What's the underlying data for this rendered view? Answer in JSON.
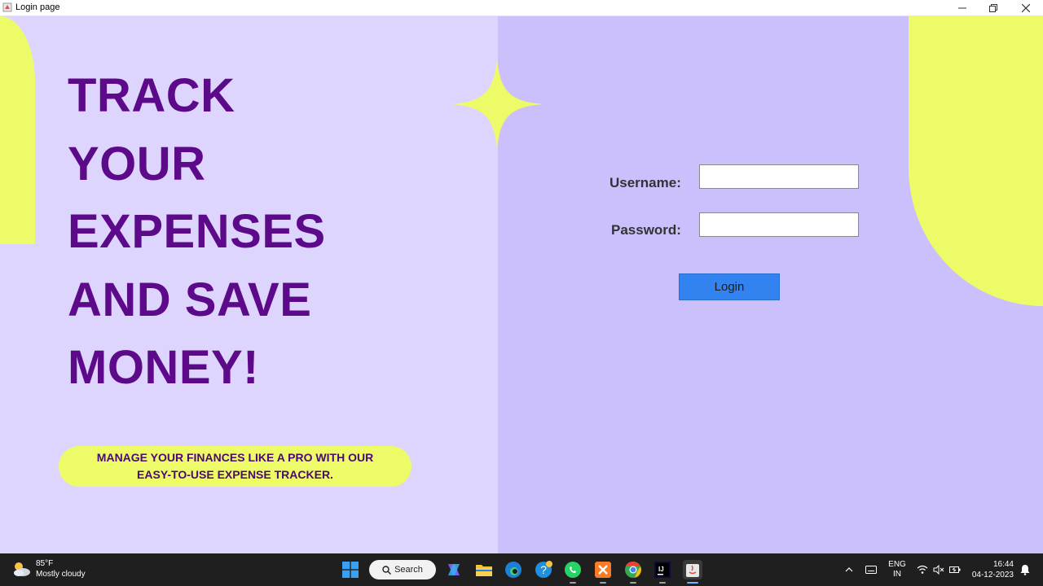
{
  "window": {
    "title": "Login page",
    "minimize_icon": "minimize-icon",
    "maximize_icon": "restore-icon",
    "close_icon": "close-icon"
  },
  "hero": {
    "headline_lines": [
      "TRACK",
      "YOUR",
      "EXPENSES",
      "AND SAVE",
      "MONEY!"
    ],
    "tagline": "MANAGE YOUR FINANCES LIKE A PRO WITH OUR EASY-TO-USE EXPENSE TRACKER."
  },
  "login_form": {
    "username_label": "Username:",
    "username_value": "",
    "password_label": "Password:",
    "password_value": "",
    "login_button": "Login"
  },
  "colors": {
    "left_bg": "#ddd5fd",
    "right_bg": "#cbc0fb",
    "accent_yellow": "#eefb69",
    "headline_purple": "#5d0a8a",
    "button_blue": "#3283f0"
  },
  "taskbar": {
    "weather_temp": "85°F",
    "weather_desc": "Mostly cloudy",
    "search_label": "Search",
    "apps": [
      "windows-start-icon",
      "copilot-icon",
      "file-explorer-icon",
      "edge-icon",
      "help-icon",
      "whatsapp-icon",
      "xampp-icon",
      "chrome-icon",
      "intellij-icon",
      "java-icon"
    ],
    "language_line1": "ENG",
    "language_line2": "IN",
    "time": "16:44",
    "date": "04-12-2023"
  }
}
